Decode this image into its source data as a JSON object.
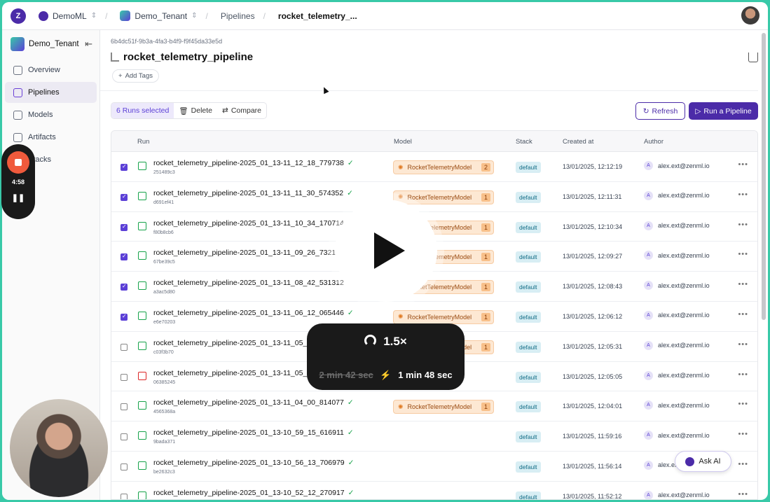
{
  "topbar": {
    "org": "DemoML",
    "tenant": "Demo_Tenant",
    "breadcrumb_pipelines": "Pipelines",
    "breadcrumb_current": "rocket_telemetry_..."
  },
  "sidebar": {
    "tenant": "Demo_Tenant",
    "items": [
      {
        "label": "Overview"
      },
      {
        "label": "Pipelines"
      },
      {
        "label": "Models"
      },
      {
        "label": "Artifacts"
      },
      {
        "label": "Stacks"
      }
    ]
  },
  "header": {
    "id": "6b4dc51f-9b3a-4fa3-b4f9-f9f45da33e5d",
    "title": "rocket_telemetry_pipeline",
    "add_tags": "Add Tags"
  },
  "toolbar": {
    "selected": "6 Runs selected",
    "delete": "Delete",
    "compare": "Compare",
    "refresh": "Refresh",
    "run_pipeline": "Run a Pipeline"
  },
  "table": {
    "columns": [
      "Run",
      "Model",
      "Stack",
      "Created at",
      "Author"
    ],
    "rows": [
      {
        "checked": true,
        "status": "success",
        "name": "rocket_telemetry_pipeline-2025_01_13-11_12_18_779738",
        "hash": "251489c3",
        "model": "RocketTelemetryModel",
        "version": "2",
        "stack": "default",
        "created": "13/01/2025, 12:12:19",
        "author": "alex.ext@zenml.io"
      },
      {
        "checked": true,
        "status": "success",
        "name": "rocket_telemetry_pipeline-2025_01_13-11_11_30_574352",
        "hash": "d691ef41",
        "model": "RocketTelemetryModel",
        "version": "1",
        "stack": "default",
        "created": "13/01/2025, 12:11:31",
        "author": "alex.ext@zenml.io"
      },
      {
        "checked": true,
        "status": "success",
        "name": "rocket_telemetry_pipeline-2025_01_13-11_10_34_170714",
        "hash": "f80b8cb6",
        "model": "RocketTelemetryModel",
        "version": "1",
        "stack": "default",
        "created": "13/01/2025, 12:10:34",
        "author": "alex.ext@zenml.io"
      },
      {
        "checked": true,
        "status": "success",
        "name": "rocket_telemetry_pipeline-2025_01_13-11_09_26_73210",
        "hash": "67be39c5",
        "model": "RocketTelemetryModel",
        "version": "1",
        "stack": "default",
        "created": "13/01/2025, 12:09:27",
        "author": "alex.ext@zenml.io"
      },
      {
        "checked": true,
        "status": "success",
        "name": "rocket_telemetry_pipeline-2025_01_13-11_08_42_531312",
        "hash": "a3ac5d80",
        "model": "RocketTelemetryModel",
        "version": "1",
        "stack": "default",
        "created": "13/01/2025, 12:08:43",
        "author": "alex.ext@zenml.io"
      },
      {
        "checked": true,
        "status": "success",
        "name": "rocket_telemetry_pipeline-2025_01_13-11_06_12_065446",
        "hash": "e6e70203",
        "model": "RocketTelemetryModel",
        "version": "1",
        "stack": "default",
        "created": "13/01/2025, 12:06:12",
        "author": "alex.ext@zenml.io"
      },
      {
        "checked": false,
        "status": "success",
        "name": "rocket_telemetry_pipeline-2025_01_13-11_05_3",
        "hash": "c03f3b70",
        "model": "RocketTelemetryModel",
        "version": "1",
        "stack": "default",
        "created": "13/01/2025, 12:05:31",
        "author": "alex.ext@zenml.io"
      },
      {
        "checked": false,
        "status": "failed",
        "name": "rocket_telemetry_pipeline-2025_01_13-11_05_0",
        "hash": "06385245",
        "model": "",
        "version": "",
        "stack": "default",
        "created": "13/01/2025, 12:05:05",
        "author": "alex.ext@zenml.io"
      },
      {
        "checked": false,
        "status": "success",
        "name": "rocket_telemetry_pipeline-2025_01_13-11_04_00_814077",
        "hash": "4565368a",
        "model": "RocketTelemetryModel",
        "version": "1",
        "stack": "default",
        "created": "13/01/2025, 12:04:01",
        "author": "alex.ext@zenml.io"
      },
      {
        "checked": false,
        "status": "success",
        "name": "rocket_telemetry_pipeline-2025_01_13-10_59_15_616911",
        "hash": "9bada371",
        "model": "",
        "version": "",
        "stack": "default",
        "created": "13/01/2025, 11:59:16",
        "author": "alex.ext@zenml.io"
      },
      {
        "checked": false,
        "status": "success",
        "name": "rocket_telemetry_pipeline-2025_01_13-10_56_13_706979",
        "hash": "be2632c3",
        "model": "",
        "version": "",
        "stack": "default",
        "created": "13/01/2025, 11:56:14",
        "author": "alex.ext@zenml.io"
      },
      {
        "checked": false,
        "status": "success",
        "name": "rocket_telemetry_pipeline-2025_01_13-10_52_12_270917",
        "hash": "73dc3dc9",
        "model": "",
        "version": "",
        "stack": "default",
        "created": "13/01/2025, 11:52:12",
        "author": "alex.ext@zenml.io"
      }
    ]
  },
  "recorder": {
    "time": "4:58"
  },
  "speed_overlay": {
    "speed": "1.5×",
    "original": "2 min 42 sec",
    "new": "1 min 48 sec"
  },
  "ask_ai": "Ask AI",
  "colors": {
    "brand": "#4b2ba8",
    "frame": "#38c9a8",
    "success": "#16a34a",
    "failed": "#dc2626"
  }
}
